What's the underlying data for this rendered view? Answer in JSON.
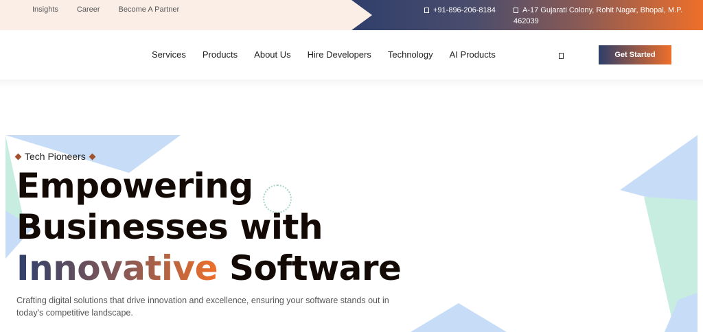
{
  "topbar": {
    "links": [
      "Insights",
      "Career",
      "Become A Partner"
    ],
    "phone": "+91-896-206-8184",
    "address": "A-17 Gujarati Colony, Rohit Nagar, Bhopal, M.P. 462039"
  },
  "nav": {
    "items": [
      "Services",
      "Products",
      "About Us",
      "Hire Developers",
      "Technology",
      "AI Products"
    ],
    "cta": "Get Started"
  },
  "hero": {
    "eyebrow": "Tech Pioneers",
    "headline_line1": "Empowering",
    "headline_line2": "Businesses with",
    "headline_highlight": "Innovative",
    "headline_line3_rest": "Software",
    "subtitle": "Crafting digital solutions that drive innovation and excellence, ensuring your software stands out in today's competitive landscape."
  },
  "colors": {
    "brand_navy": "#2f3f6b",
    "brand_orange": "#ee6f2a",
    "topbar_bg": "#fbeee6",
    "shape_blue": "#c7dcf7",
    "shape_mint": "#c6ede0"
  },
  "icons": {
    "phone": "phone-icon",
    "address": "location-icon",
    "search": "search-icon"
  }
}
